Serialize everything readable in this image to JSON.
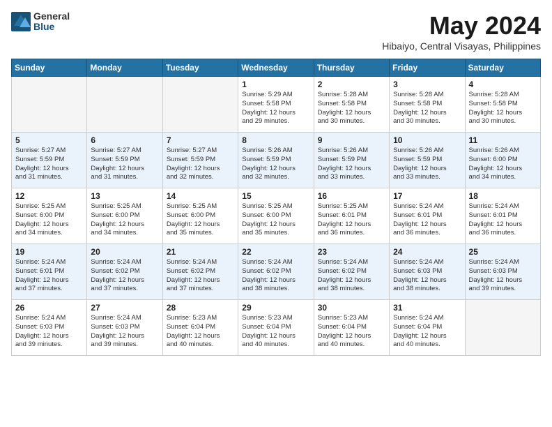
{
  "logo": {
    "general": "General",
    "blue": "Blue"
  },
  "title": "May 2024",
  "location": "Hibaiyo, Central Visayas, Philippines",
  "weekdays": [
    "Sunday",
    "Monday",
    "Tuesday",
    "Wednesday",
    "Thursday",
    "Friday",
    "Saturday"
  ],
  "weeks": [
    [
      {
        "day": "",
        "info": ""
      },
      {
        "day": "",
        "info": ""
      },
      {
        "day": "",
        "info": ""
      },
      {
        "day": "1",
        "info": "Sunrise: 5:29 AM\nSunset: 5:58 PM\nDaylight: 12 hours\nand 29 minutes."
      },
      {
        "day": "2",
        "info": "Sunrise: 5:28 AM\nSunset: 5:58 PM\nDaylight: 12 hours\nand 30 minutes."
      },
      {
        "day": "3",
        "info": "Sunrise: 5:28 AM\nSunset: 5:58 PM\nDaylight: 12 hours\nand 30 minutes."
      },
      {
        "day": "4",
        "info": "Sunrise: 5:28 AM\nSunset: 5:58 PM\nDaylight: 12 hours\nand 30 minutes."
      }
    ],
    [
      {
        "day": "5",
        "info": "Sunrise: 5:27 AM\nSunset: 5:59 PM\nDaylight: 12 hours\nand 31 minutes."
      },
      {
        "day": "6",
        "info": "Sunrise: 5:27 AM\nSunset: 5:59 PM\nDaylight: 12 hours\nand 31 minutes."
      },
      {
        "day": "7",
        "info": "Sunrise: 5:27 AM\nSunset: 5:59 PM\nDaylight: 12 hours\nand 32 minutes."
      },
      {
        "day": "8",
        "info": "Sunrise: 5:26 AM\nSunset: 5:59 PM\nDaylight: 12 hours\nand 32 minutes."
      },
      {
        "day": "9",
        "info": "Sunrise: 5:26 AM\nSunset: 5:59 PM\nDaylight: 12 hours\nand 33 minutes."
      },
      {
        "day": "10",
        "info": "Sunrise: 5:26 AM\nSunset: 5:59 PM\nDaylight: 12 hours\nand 33 minutes."
      },
      {
        "day": "11",
        "info": "Sunrise: 5:26 AM\nSunset: 6:00 PM\nDaylight: 12 hours\nand 34 minutes."
      }
    ],
    [
      {
        "day": "12",
        "info": "Sunrise: 5:25 AM\nSunset: 6:00 PM\nDaylight: 12 hours\nand 34 minutes."
      },
      {
        "day": "13",
        "info": "Sunrise: 5:25 AM\nSunset: 6:00 PM\nDaylight: 12 hours\nand 34 minutes."
      },
      {
        "day": "14",
        "info": "Sunrise: 5:25 AM\nSunset: 6:00 PM\nDaylight: 12 hours\nand 35 minutes."
      },
      {
        "day": "15",
        "info": "Sunrise: 5:25 AM\nSunset: 6:00 PM\nDaylight: 12 hours\nand 35 minutes."
      },
      {
        "day": "16",
        "info": "Sunrise: 5:25 AM\nSunset: 6:01 PM\nDaylight: 12 hours\nand 36 minutes."
      },
      {
        "day": "17",
        "info": "Sunrise: 5:24 AM\nSunset: 6:01 PM\nDaylight: 12 hours\nand 36 minutes."
      },
      {
        "day": "18",
        "info": "Sunrise: 5:24 AM\nSunset: 6:01 PM\nDaylight: 12 hours\nand 36 minutes."
      }
    ],
    [
      {
        "day": "19",
        "info": "Sunrise: 5:24 AM\nSunset: 6:01 PM\nDaylight: 12 hours\nand 37 minutes."
      },
      {
        "day": "20",
        "info": "Sunrise: 5:24 AM\nSunset: 6:02 PM\nDaylight: 12 hours\nand 37 minutes."
      },
      {
        "day": "21",
        "info": "Sunrise: 5:24 AM\nSunset: 6:02 PM\nDaylight: 12 hours\nand 37 minutes."
      },
      {
        "day": "22",
        "info": "Sunrise: 5:24 AM\nSunset: 6:02 PM\nDaylight: 12 hours\nand 38 minutes."
      },
      {
        "day": "23",
        "info": "Sunrise: 5:24 AM\nSunset: 6:02 PM\nDaylight: 12 hours\nand 38 minutes."
      },
      {
        "day": "24",
        "info": "Sunrise: 5:24 AM\nSunset: 6:03 PM\nDaylight: 12 hours\nand 38 minutes."
      },
      {
        "day": "25",
        "info": "Sunrise: 5:24 AM\nSunset: 6:03 PM\nDaylight: 12 hours\nand 39 minutes."
      }
    ],
    [
      {
        "day": "26",
        "info": "Sunrise: 5:24 AM\nSunset: 6:03 PM\nDaylight: 12 hours\nand 39 minutes."
      },
      {
        "day": "27",
        "info": "Sunrise: 5:24 AM\nSunset: 6:03 PM\nDaylight: 12 hours\nand 39 minutes."
      },
      {
        "day": "28",
        "info": "Sunrise: 5:23 AM\nSunset: 6:04 PM\nDaylight: 12 hours\nand 40 minutes."
      },
      {
        "day": "29",
        "info": "Sunrise: 5:23 AM\nSunset: 6:04 PM\nDaylight: 12 hours\nand 40 minutes."
      },
      {
        "day": "30",
        "info": "Sunrise: 5:23 AM\nSunset: 6:04 PM\nDaylight: 12 hours\nand 40 minutes."
      },
      {
        "day": "31",
        "info": "Sunrise: 5:24 AM\nSunset: 6:04 PM\nDaylight: 12 hours\nand 40 minutes."
      },
      {
        "day": "",
        "info": ""
      }
    ]
  ]
}
